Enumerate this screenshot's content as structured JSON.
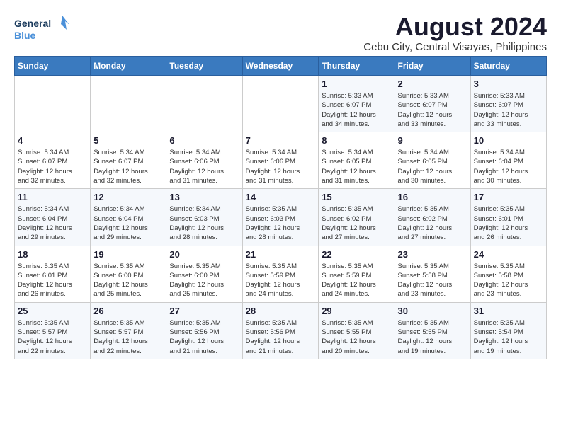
{
  "logo": {
    "line1": "General",
    "line2": "Blue"
  },
  "title": "August 2024",
  "location": "Cebu City, Central Visayas, Philippines",
  "weekdays": [
    "Sunday",
    "Monday",
    "Tuesday",
    "Wednesday",
    "Thursday",
    "Friday",
    "Saturday"
  ],
  "weeks": [
    [
      {
        "day": "",
        "info": ""
      },
      {
        "day": "",
        "info": ""
      },
      {
        "day": "",
        "info": ""
      },
      {
        "day": "",
        "info": ""
      },
      {
        "day": "1",
        "info": "Sunrise: 5:33 AM\nSunset: 6:07 PM\nDaylight: 12 hours\nand 34 minutes."
      },
      {
        "day": "2",
        "info": "Sunrise: 5:33 AM\nSunset: 6:07 PM\nDaylight: 12 hours\nand 33 minutes."
      },
      {
        "day": "3",
        "info": "Sunrise: 5:33 AM\nSunset: 6:07 PM\nDaylight: 12 hours\nand 33 minutes."
      }
    ],
    [
      {
        "day": "4",
        "info": "Sunrise: 5:34 AM\nSunset: 6:07 PM\nDaylight: 12 hours\nand 32 minutes."
      },
      {
        "day": "5",
        "info": "Sunrise: 5:34 AM\nSunset: 6:07 PM\nDaylight: 12 hours\nand 32 minutes."
      },
      {
        "day": "6",
        "info": "Sunrise: 5:34 AM\nSunset: 6:06 PM\nDaylight: 12 hours\nand 31 minutes."
      },
      {
        "day": "7",
        "info": "Sunrise: 5:34 AM\nSunset: 6:06 PM\nDaylight: 12 hours\nand 31 minutes."
      },
      {
        "day": "8",
        "info": "Sunrise: 5:34 AM\nSunset: 6:05 PM\nDaylight: 12 hours\nand 31 minutes."
      },
      {
        "day": "9",
        "info": "Sunrise: 5:34 AM\nSunset: 6:05 PM\nDaylight: 12 hours\nand 30 minutes."
      },
      {
        "day": "10",
        "info": "Sunrise: 5:34 AM\nSunset: 6:04 PM\nDaylight: 12 hours\nand 30 minutes."
      }
    ],
    [
      {
        "day": "11",
        "info": "Sunrise: 5:34 AM\nSunset: 6:04 PM\nDaylight: 12 hours\nand 29 minutes."
      },
      {
        "day": "12",
        "info": "Sunrise: 5:34 AM\nSunset: 6:04 PM\nDaylight: 12 hours\nand 29 minutes."
      },
      {
        "day": "13",
        "info": "Sunrise: 5:34 AM\nSunset: 6:03 PM\nDaylight: 12 hours\nand 28 minutes."
      },
      {
        "day": "14",
        "info": "Sunrise: 5:35 AM\nSunset: 6:03 PM\nDaylight: 12 hours\nand 28 minutes."
      },
      {
        "day": "15",
        "info": "Sunrise: 5:35 AM\nSunset: 6:02 PM\nDaylight: 12 hours\nand 27 minutes."
      },
      {
        "day": "16",
        "info": "Sunrise: 5:35 AM\nSunset: 6:02 PM\nDaylight: 12 hours\nand 27 minutes."
      },
      {
        "day": "17",
        "info": "Sunrise: 5:35 AM\nSunset: 6:01 PM\nDaylight: 12 hours\nand 26 minutes."
      }
    ],
    [
      {
        "day": "18",
        "info": "Sunrise: 5:35 AM\nSunset: 6:01 PM\nDaylight: 12 hours\nand 26 minutes."
      },
      {
        "day": "19",
        "info": "Sunrise: 5:35 AM\nSunset: 6:00 PM\nDaylight: 12 hours\nand 25 minutes."
      },
      {
        "day": "20",
        "info": "Sunrise: 5:35 AM\nSunset: 6:00 PM\nDaylight: 12 hours\nand 25 minutes."
      },
      {
        "day": "21",
        "info": "Sunrise: 5:35 AM\nSunset: 5:59 PM\nDaylight: 12 hours\nand 24 minutes."
      },
      {
        "day": "22",
        "info": "Sunrise: 5:35 AM\nSunset: 5:59 PM\nDaylight: 12 hours\nand 24 minutes."
      },
      {
        "day": "23",
        "info": "Sunrise: 5:35 AM\nSunset: 5:58 PM\nDaylight: 12 hours\nand 23 minutes."
      },
      {
        "day": "24",
        "info": "Sunrise: 5:35 AM\nSunset: 5:58 PM\nDaylight: 12 hours\nand 23 minutes."
      }
    ],
    [
      {
        "day": "25",
        "info": "Sunrise: 5:35 AM\nSunset: 5:57 PM\nDaylight: 12 hours\nand 22 minutes."
      },
      {
        "day": "26",
        "info": "Sunrise: 5:35 AM\nSunset: 5:57 PM\nDaylight: 12 hours\nand 22 minutes."
      },
      {
        "day": "27",
        "info": "Sunrise: 5:35 AM\nSunset: 5:56 PM\nDaylight: 12 hours\nand 21 minutes."
      },
      {
        "day": "28",
        "info": "Sunrise: 5:35 AM\nSunset: 5:56 PM\nDaylight: 12 hours\nand 21 minutes."
      },
      {
        "day": "29",
        "info": "Sunrise: 5:35 AM\nSunset: 5:55 PM\nDaylight: 12 hours\nand 20 minutes."
      },
      {
        "day": "30",
        "info": "Sunrise: 5:35 AM\nSunset: 5:55 PM\nDaylight: 12 hours\nand 19 minutes."
      },
      {
        "day": "31",
        "info": "Sunrise: 5:35 AM\nSunset: 5:54 PM\nDaylight: 12 hours\nand 19 minutes."
      }
    ]
  ]
}
